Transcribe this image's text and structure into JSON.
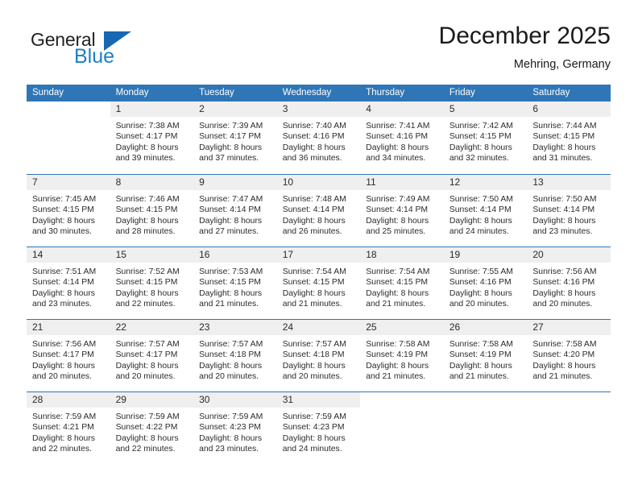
{
  "brand": {
    "name_top": "General",
    "name_bottom": "Blue",
    "triangle_color": "#1668b3",
    "blue_color": "#1d7fc3"
  },
  "header": {
    "title": "December 2025",
    "subtitle": "Mehring, Germany"
  },
  "theme": {
    "header_blue": "#2f76b6",
    "row_divider_blue": "#2f76b6",
    "daynum_band": "#efefef",
    "text": "#2b2b2b"
  },
  "labels": {
    "sunrise_prefix": "Sunrise:",
    "sunset_prefix": "Sunset:",
    "daylight_prefix": "Daylight:"
  },
  "weekday_headers": [
    "Sunday",
    "Monday",
    "Tuesday",
    "Wednesday",
    "Thursday",
    "Friday",
    "Saturday"
  ],
  "weeks": [
    [
      {
        "day": "",
        "sunrise": "",
        "sunset": "",
        "daylight_line1": "",
        "daylight_line2": "",
        "blank": true
      },
      {
        "day": "1",
        "sunrise": "Sunrise: 7:38 AM",
        "sunset": "Sunset: 4:17 PM",
        "daylight_line1": "Daylight: 8 hours",
        "daylight_line2": "and 39 minutes."
      },
      {
        "day": "2",
        "sunrise": "Sunrise: 7:39 AM",
        "sunset": "Sunset: 4:17 PM",
        "daylight_line1": "Daylight: 8 hours",
        "daylight_line2": "and 37 minutes."
      },
      {
        "day": "3",
        "sunrise": "Sunrise: 7:40 AM",
        "sunset": "Sunset: 4:16 PM",
        "daylight_line1": "Daylight: 8 hours",
        "daylight_line2": "and 36 minutes."
      },
      {
        "day": "4",
        "sunrise": "Sunrise: 7:41 AM",
        "sunset": "Sunset: 4:16 PM",
        "daylight_line1": "Daylight: 8 hours",
        "daylight_line2": "and 34 minutes."
      },
      {
        "day": "5",
        "sunrise": "Sunrise: 7:42 AM",
        "sunset": "Sunset: 4:15 PM",
        "daylight_line1": "Daylight: 8 hours",
        "daylight_line2": "and 32 minutes."
      },
      {
        "day": "6",
        "sunrise": "Sunrise: 7:44 AM",
        "sunset": "Sunset: 4:15 PM",
        "daylight_line1": "Daylight: 8 hours",
        "daylight_line2": "and 31 minutes."
      }
    ],
    [
      {
        "day": "7",
        "sunrise": "Sunrise: 7:45 AM",
        "sunset": "Sunset: 4:15 PM",
        "daylight_line1": "Daylight: 8 hours",
        "daylight_line2": "and 30 minutes."
      },
      {
        "day": "8",
        "sunrise": "Sunrise: 7:46 AM",
        "sunset": "Sunset: 4:15 PM",
        "daylight_line1": "Daylight: 8 hours",
        "daylight_line2": "and 28 minutes."
      },
      {
        "day": "9",
        "sunrise": "Sunrise: 7:47 AM",
        "sunset": "Sunset: 4:14 PM",
        "daylight_line1": "Daylight: 8 hours",
        "daylight_line2": "and 27 minutes."
      },
      {
        "day": "10",
        "sunrise": "Sunrise: 7:48 AM",
        "sunset": "Sunset: 4:14 PM",
        "daylight_line1": "Daylight: 8 hours",
        "daylight_line2": "and 26 minutes."
      },
      {
        "day": "11",
        "sunrise": "Sunrise: 7:49 AM",
        "sunset": "Sunset: 4:14 PM",
        "daylight_line1": "Daylight: 8 hours",
        "daylight_line2": "and 25 minutes."
      },
      {
        "day": "12",
        "sunrise": "Sunrise: 7:50 AM",
        "sunset": "Sunset: 4:14 PM",
        "daylight_line1": "Daylight: 8 hours",
        "daylight_line2": "and 24 minutes."
      },
      {
        "day": "13",
        "sunrise": "Sunrise: 7:50 AM",
        "sunset": "Sunset: 4:14 PM",
        "daylight_line1": "Daylight: 8 hours",
        "daylight_line2": "and 23 minutes."
      }
    ],
    [
      {
        "day": "14",
        "sunrise": "Sunrise: 7:51 AM",
        "sunset": "Sunset: 4:14 PM",
        "daylight_line1": "Daylight: 8 hours",
        "daylight_line2": "and 23 minutes."
      },
      {
        "day": "15",
        "sunrise": "Sunrise: 7:52 AM",
        "sunset": "Sunset: 4:15 PM",
        "daylight_line1": "Daylight: 8 hours",
        "daylight_line2": "and 22 minutes."
      },
      {
        "day": "16",
        "sunrise": "Sunrise: 7:53 AM",
        "sunset": "Sunset: 4:15 PM",
        "daylight_line1": "Daylight: 8 hours",
        "daylight_line2": "and 21 minutes."
      },
      {
        "day": "17",
        "sunrise": "Sunrise: 7:54 AM",
        "sunset": "Sunset: 4:15 PM",
        "daylight_line1": "Daylight: 8 hours",
        "daylight_line2": "and 21 minutes."
      },
      {
        "day": "18",
        "sunrise": "Sunrise: 7:54 AM",
        "sunset": "Sunset: 4:15 PM",
        "daylight_line1": "Daylight: 8 hours",
        "daylight_line2": "and 21 minutes."
      },
      {
        "day": "19",
        "sunrise": "Sunrise: 7:55 AM",
        "sunset": "Sunset: 4:16 PM",
        "daylight_line1": "Daylight: 8 hours",
        "daylight_line2": "and 20 minutes."
      },
      {
        "day": "20",
        "sunrise": "Sunrise: 7:56 AM",
        "sunset": "Sunset: 4:16 PM",
        "daylight_line1": "Daylight: 8 hours",
        "daylight_line2": "and 20 minutes."
      }
    ],
    [
      {
        "day": "21",
        "sunrise": "Sunrise: 7:56 AM",
        "sunset": "Sunset: 4:17 PM",
        "daylight_line1": "Daylight: 8 hours",
        "daylight_line2": "and 20 minutes."
      },
      {
        "day": "22",
        "sunrise": "Sunrise: 7:57 AM",
        "sunset": "Sunset: 4:17 PM",
        "daylight_line1": "Daylight: 8 hours",
        "daylight_line2": "and 20 minutes."
      },
      {
        "day": "23",
        "sunrise": "Sunrise: 7:57 AM",
        "sunset": "Sunset: 4:18 PM",
        "daylight_line1": "Daylight: 8 hours",
        "daylight_line2": "and 20 minutes."
      },
      {
        "day": "24",
        "sunrise": "Sunrise: 7:57 AM",
        "sunset": "Sunset: 4:18 PM",
        "daylight_line1": "Daylight: 8 hours",
        "daylight_line2": "and 20 minutes."
      },
      {
        "day": "25",
        "sunrise": "Sunrise: 7:58 AM",
        "sunset": "Sunset: 4:19 PM",
        "daylight_line1": "Daylight: 8 hours",
        "daylight_line2": "and 21 minutes."
      },
      {
        "day": "26",
        "sunrise": "Sunrise: 7:58 AM",
        "sunset": "Sunset: 4:19 PM",
        "daylight_line1": "Daylight: 8 hours",
        "daylight_line2": "and 21 minutes."
      },
      {
        "day": "27",
        "sunrise": "Sunrise: 7:58 AM",
        "sunset": "Sunset: 4:20 PM",
        "daylight_line1": "Daylight: 8 hours",
        "daylight_line2": "and 21 minutes."
      }
    ],
    [
      {
        "day": "28",
        "sunrise": "Sunrise: 7:59 AM",
        "sunset": "Sunset: 4:21 PM",
        "daylight_line1": "Daylight: 8 hours",
        "daylight_line2": "and 22 minutes."
      },
      {
        "day": "29",
        "sunrise": "Sunrise: 7:59 AM",
        "sunset": "Sunset: 4:22 PM",
        "daylight_line1": "Daylight: 8 hours",
        "daylight_line2": "and 22 minutes."
      },
      {
        "day": "30",
        "sunrise": "Sunrise: 7:59 AM",
        "sunset": "Sunset: 4:23 PM",
        "daylight_line1": "Daylight: 8 hours",
        "daylight_line2": "and 23 minutes."
      },
      {
        "day": "31",
        "sunrise": "Sunrise: 7:59 AM",
        "sunset": "Sunset: 4:23 PM",
        "daylight_line1": "Daylight: 8 hours",
        "daylight_line2": "and 24 minutes."
      },
      {
        "day": "",
        "sunrise": "",
        "sunset": "",
        "daylight_line1": "",
        "daylight_line2": "",
        "blank": true
      },
      {
        "day": "",
        "sunrise": "",
        "sunset": "",
        "daylight_line1": "",
        "daylight_line2": "",
        "blank": true
      },
      {
        "day": "",
        "sunrise": "",
        "sunset": "",
        "daylight_line1": "",
        "daylight_line2": "",
        "blank": true
      }
    ]
  ]
}
